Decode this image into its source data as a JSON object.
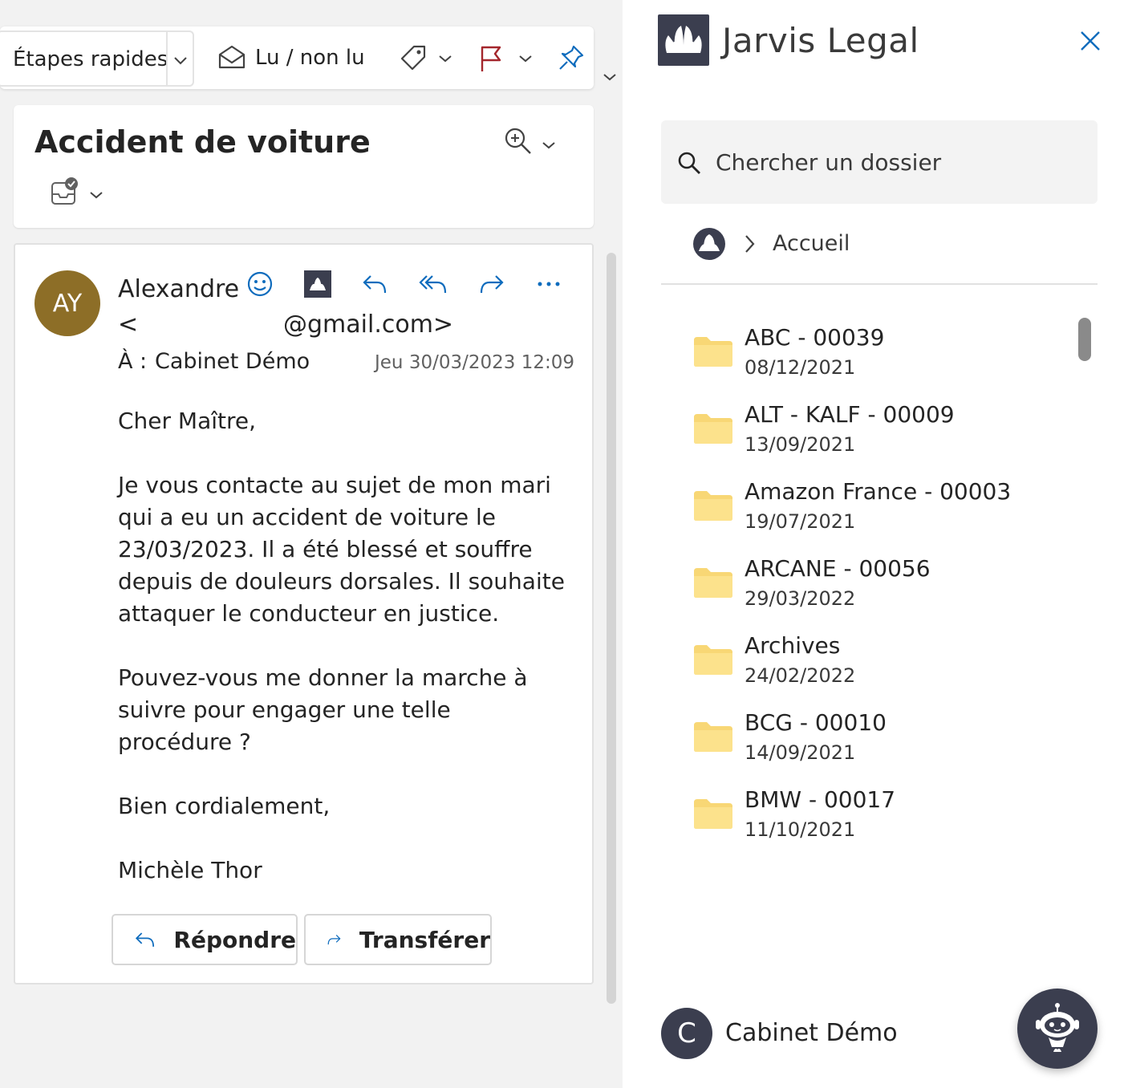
{
  "toolbar": {
    "quick_steps_label": "Étapes rapides",
    "read_unread_label": "Lu / non lu"
  },
  "message": {
    "subject": "Accident de voiture",
    "sender_initials": "AY",
    "sender_name": "Alexandre",
    "sender_email_prefix": "<",
    "sender_email_suffix": "@gmail.com>",
    "to_label": "À :",
    "to_value": "Cabinet Démo",
    "date": "Jeu 30/03/2023 12:09",
    "greeting": "Cher Maître,",
    "paragraph1": "Je vous contacte au sujet de mon mari qui a eu un accident de voiture le 23/03/2023. Il a été blessé et souffre depuis de douleurs dorsales. Il souhaite attaquer le conducteur en justice.",
    "paragraph2": "Pouvez-vous me donner la marche à suivre pour engager une telle procédure ?",
    "closing": "Bien cordialement,",
    "signature": "Michèle Thor",
    "reply_label": "Répondre",
    "forward_label": "Transférer"
  },
  "addin": {
    "title": "Jarvis Legal",
    "search_placeholder": "Chercher un dossier",
    "breadcrumb_home": "Accueil",
    "folders": [
      {
        "name": "ABC - 00039",
        "date": "08/12/2021"
      },
      {
        "name": "ALT - KALF - 00009",
        "date": "13/09/2021"
      },
      {
        "name": "Amazon France - 00003",
        "date": "19/07/2021"
      },
      {
        "name": "ARCANE - 00056",
        "date": "29/03/2022"
      },
      {
        "name": "Archives",
        "date": "24/02/2022"
      },
      {
        "name": "BCG - 00010",
        "date": "14/09/2021"
      },
      {
        "name": "BMW - 00017",
        "date": "11/10/2021"
      }
    ],
    "user_initial": "C",
    "user_name": "Cabinet Démo"
  },
  "colors": {
    "brand_dark": "#3b3e4f",
    "accent_blue": "#0f6cbd",
    "flag_red": "#a4262c",
    "folder_yellow": "#f8d775",
    "avatar_gold": "#8d6e27"
  },
  "icons": {
    "toolbar": [
      "chevron-down-icon",
      "envelope-open-icon",
      "tag-icon",
      "flag-icon",
      "pin-icon"
    ],
    "header": [
      "zoom-icon",
      "inbox-check-icon"
    ],
    "actions": [
      "emoji-icon",
      "jarvis-logo-icon",
      "reply-icon",
      "reply-all-icon",
      "forward-icon",
      "more-icon"
    ],
    "addin": [
      "close-icon",
      "search-icon",
      "home-logo-icon",
      "chevron-right-icon",
      "folder-icon",
      "robot-assistant-icon"
    ]
  }
}
